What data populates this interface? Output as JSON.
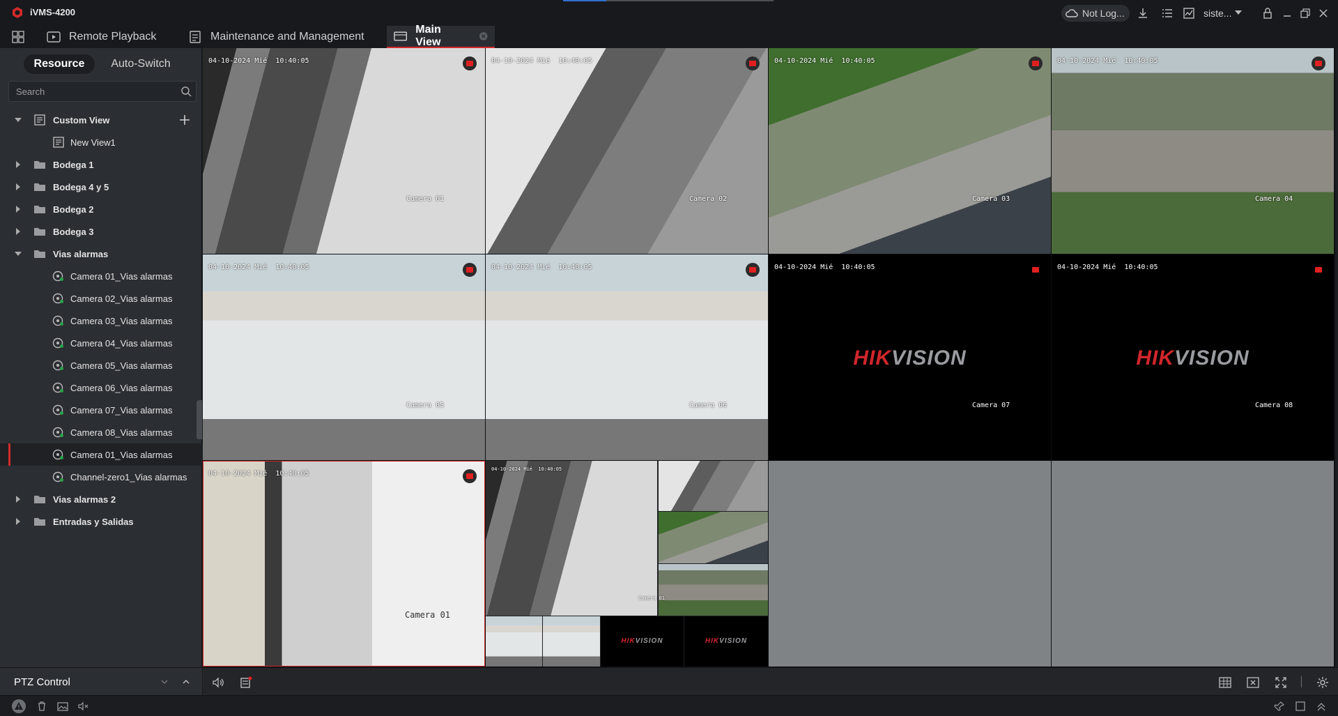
{
  "app": {
    "title": "iVMS-4200"
  },
  "titlebar": {
    "login_status": "Not Log...",
    "user": "siste..."
  },
  "tabs": [
    {
      "label": "Remote Playback"
    },
    {
      "label": "Maintenance and Management"
    },
    {
      "label": "Main View"
    }
  ],
  "sidebar": {
    "segments": [
      "Resource",
      "Auto-Switch"
    ],
    "search_placeholder": "Search",
    "tree": [
      {
        "label": "Custom View",
        "type": "view-group",
        "expanded": true
      },
      {
        "label": "New View1",
        "type": "view"
      },
      {
        "label": "Bodega 1",
        "type": "folder",
        "expanded": false
      },
      {
        "label": "Bodega 4 y 5",
        "type": "folder",
        "expanded": false
      },
      {
        "label": "Bodega 2",
        "type": "folder",
        "expanded": false
      },
      {
        "label": "Bodega 3",
        "type": "folder",
        "expanded": false
      },
      {
        "label": "Vias alarmas",
        "type": "folder",
        "expanded": true
      },
      {
        "label": "Camera 01_Vias alarmas",
        "type": "camera"
      },
      {
        "label": "Camera 02_Vias alarmas",
        "type": "camera"
      },
      {
        "label": "Camera 03_Vias alarmas",
        "type": "camera"
      },
      {
        "label": "Camera 04_Vias alarmas",
        "type": "camera"
      },
      {
        "label": "Camera 05_Vias alarmas",
        "type": "camera"
      },
      {
        "label": "Camera 06_Vias alarmas",
        "type": "camera"
      },
      {
        "label": "Camera 07_Vias alarmas",
        "type": "camera"
      },
      {
        "label": "Camera 08_Vias alarmas",
        "type": "camera"
      },
      {
        "label": "Camera 01_Vias alarmas",
        "type": "camera",
        "selected": true
      },
      {
        "label": "Channel-zero1_Vias alarmas",
        "type": "camera"
      },
      {
        "label": "Vias alarmas 2",
        "type": "folder",
        "expanded": false
      },
      {
        "label": "Entradas y Salidas",
        "type": "folder",
        "expanded": false
      }
    ],
    "ptz_label": "PTZ Control"
  },
  "video": {
    "timestamp": "04-10-2024 Mié  10:40:05",
    "tiles": [
      {
        "camera": "Camera 01",
        "scene": "warehouse"
      },
      {
        "camera": "Camera 02",
        "scene": "warehouse2"
      },
      {
        "camera": "Camera 03",
        "scene": "yard1"
      },
      {
        "camera": "Camera 04",
        "scene": "yard2"
      },
      {
        "camera": "Camera 05",
        "scene": "bags"
      },
      {
        "camera": "Camera 06",
        "scene": "bags"
      },
      {
        "camera": "Camera 07",
        "scene": "no-signal",
        "logo": [
          "HIK",
          "VISION"
        ]
      },
      {
        "camera": "Camera 08",
        "scene": "no-signal",
        "logo": [
          "HIK",
          "VISION"
        ]
      },
      {
        "camera": "Camera 01",
        "scene": "office",
        "selected": true
      },
      {
        "camera": "Camera 01",
        "scene": "channel-zero"
      },
      {
        "camera": "",
        "scene": "empty"
      },
      {
        "camera": "",
        "scene": "empty"
      }
    ]
  },
  "colors": {
    "accent": "#d12a2a",
    "panel": "#2b2e33",
    "background": "#1b1d20"
  }
}
